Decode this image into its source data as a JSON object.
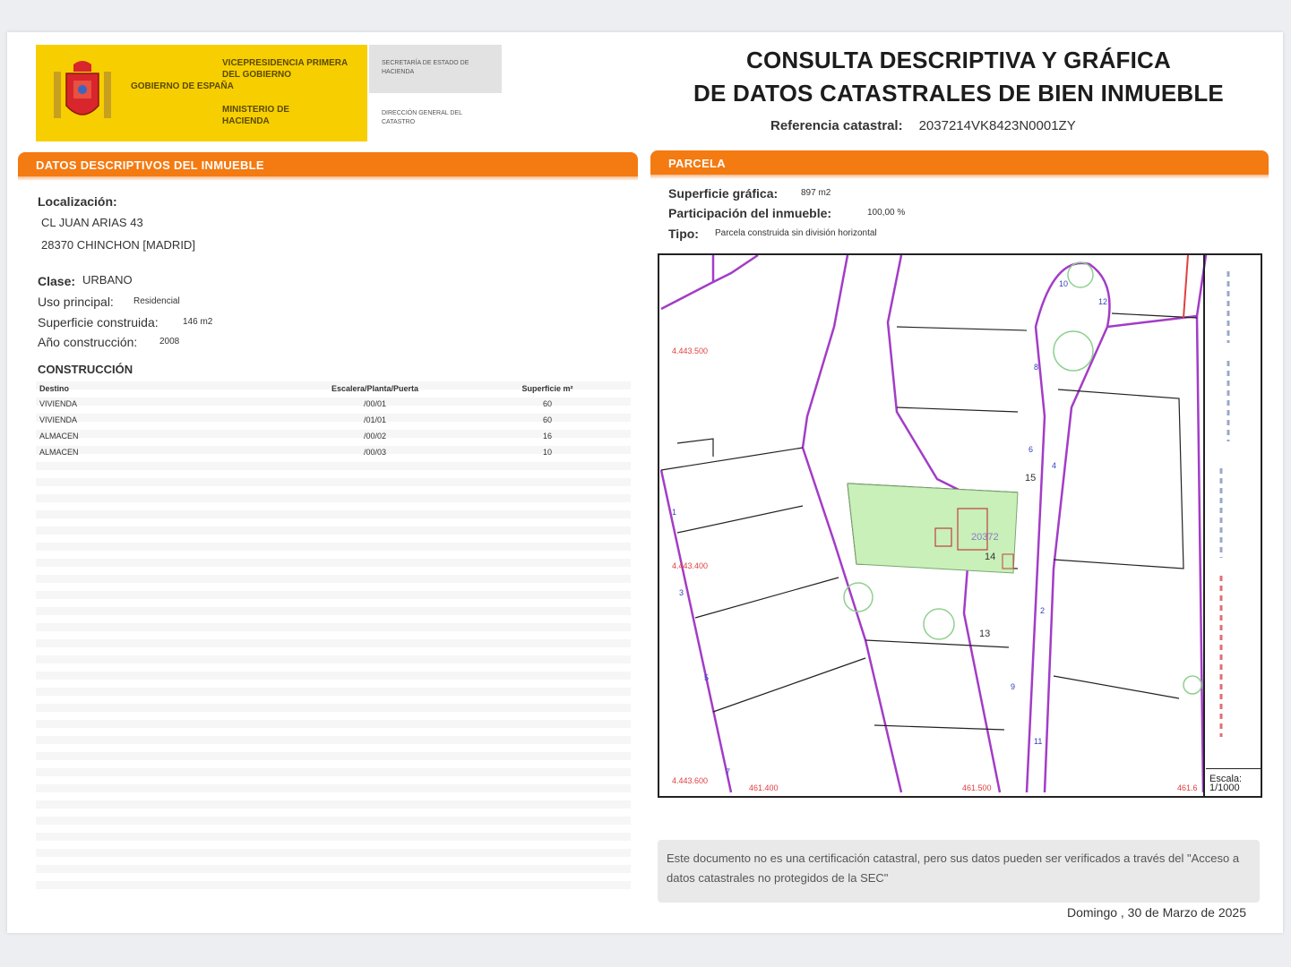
{
  "header": {
    "logo_gobierno": "GOBIERNO DE ESPAÑA",
    "logo_vicepresidencia": "VICEPRESIDENCIA PRIMERA DEL GOBIERNO",
    "logo_ministerio": "MINISTERIO DE HACIENDA",
    "logo_secretaria": "SECRETARÍA DE ESTADO DE HACIENDA",
    "logo_direccion": "DIRECCIÓN GENERAL DEL CATASTRO",
    "title_line1": "CONSULTA DESCRIPTIVA Y GRÁFICA",
    "title_line2": "DE DATOS CATASTRALES DE BIEN INMUEBLE",
    "ref_label": "Referencia catastral:",
    "ref_value": "2037214VK8423N0001ZY"
  },
  "descriptivos": {
    "bar_title": "DATOS DESCRIPTIVOS DEL INMUEBLE",
    "localizacion_label": "Localización:",
    "direccion_1": "CL JUAN ARIAS 43",
    "direccion_2": "28370 CHINCHON [MADRID]",
    "clase_label": "Clase:",
    "clase_value": "URBANO",
    "uso_label": "Uso principal:",
    "uso_value": "Residencial",
    "superficie_label": "Superficie construida:",
    "superficie_value": "146 m2",
    "anio_label": "Año construcción:",
    "anio_value": "2008",
    "construccion_title": "CONSTRUCCIÓN",
    "table_headers": [
      "Destino",
      "Escalera/Planta/Puerta",
      "Superficie m²"
    ],
    "table_rows": [
      [
        "VIVIENDA",
        "/00/01",
        "60"
      ],
      [
        "VIVIENDA",
        "/01/01",
        "60"
      ],
      [
        "ALMACEN",
        "/00/02",
        "16"
      ],
      [
        "ALMACEN",
        "/00/03",
        "10"
      ]
    ]
  },
  "parcela": {
    "bar_title": "PARCELA",
    "sup_grafica_label": "Superficie gráfica:",
    "sup_grafica_value": "897 m2",
    "participacion_label": "Participación del inmueble:",
    "participacion_value": "100,00 %",
    "tipo_label": "Tipo:",
    "tipo_value": "Parcela construida sin división horizontal",
    "map_labels": {
      "coord_y1": "4.443.500",
      "coord_y2": "4.443.400",
      "coord_y3": "4.443.600",
      "coord_x1": "461.400",
      "coord_x2": "461.500",
      "coord_x3": "461.6",
      "lot_15": "15",
      "lot_14": "14",
      "lot_13": "13",
      "parcel_ref": "20372"
    },
    "escala_label": "Escala:",
    "escala_value": "1/1000"
  },
  "footer": {
    "note": "Este documento no es una certificación catastral, pero sus datos pueden ser verificados a través del \"Acceso a datos catastrales no protegidos de la SEC\"",
    "date": "Domingo , 30 de Marzo de 2025"
  },
  "colors": {
    "orange": "#f47a12",
    "yellow": "#f7cf00",
    "parcel_fill": "#c8f0b8",
    "boundary": "#a33cc7"
  }
}
